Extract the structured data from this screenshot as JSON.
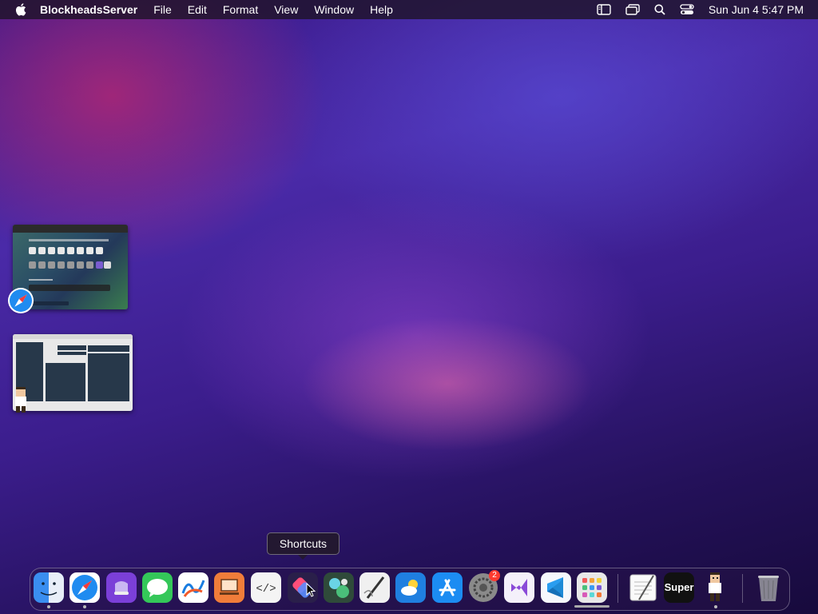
{
  "menubar": {
    "app_name": "BlockheadsServer",
    "menus": [
      "File",
      "Edit",
      "Format",
      "View",
      "Window",
      "Help"
    ],
    "clock": "Sun Jun 4  5:47 PM",
    "status_icons": [
      "sidebar-icon",
      "windows-icon",
      "search-icon",
      "control-center-icon"
    ]
  },
  "tooltip": {
    "label": "Shortcuts"
  },
  "dock": {
    "apps": [
      "Finder",
      "Safari",
      "Podcasts",
      "Messages",
      "Freeform",
      "Keynote",
      "Script Editor",
      "Shortcuts",
      "Palette",
      "Script Pencil",
      "Weather",
      "App Store",
      "System Settings",
      "Visual Studio",
      "Visual Studio Code",
      "Launchpad",
      "TextEdit",
      "Super",
      "Blockheads",
      "Trash"
    ],
    "badge_system_settings": "2",
    "super_label": "Super"
  },
  "colors": {
    "menubar": "#1e1428",
    "tooltip_bg": "#231930"
  }
}
